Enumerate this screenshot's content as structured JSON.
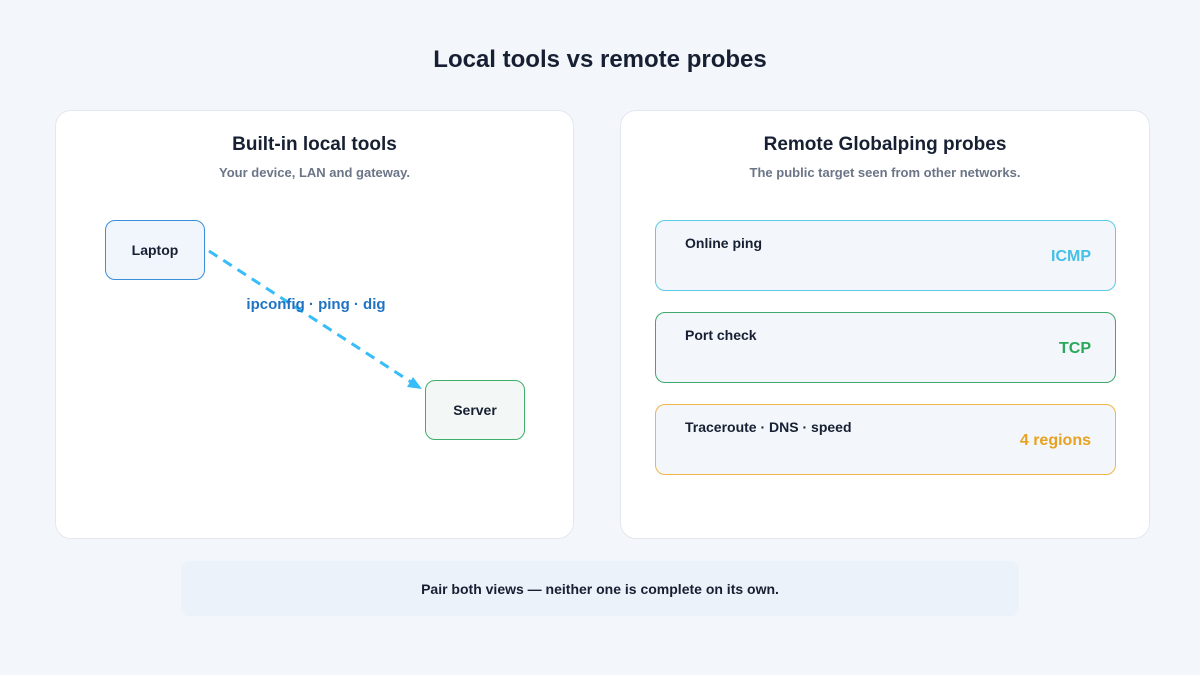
{
  "page": {
    "title": "Local tools vs remote probes"
  },
  "local_panel": {
    "title": "Built-in local tools",
    "subtitle": "Your device, LAN and gateway.",
    "source_node": "Laptop",
    "target_node": "Server",
    "edge_label": "ipconfig · ping · dig",
    "edge_color": "#38bdf8"
  },
  "remote_panel": {
    "title": "Remote Globalping probes",
    "subtitle": "The public target seen from other networks.",
    "probes": [
      {
        "name": "Online ping",
        "tag": "ICMP",
        "color": "#5ccbe8"
      },
      {
        "name": "Port check",
        "tag": "TCP",
        "color": "#3fa86a"
      },
      {
        "name": "Traceroute · DNS · speed",
        "tag": "4 regions",
        "color": "#f0b64a"
      }
    ]
  },
  "footer": {
    "note": "Pair both views — neither one is complete on its own."
  }
}
